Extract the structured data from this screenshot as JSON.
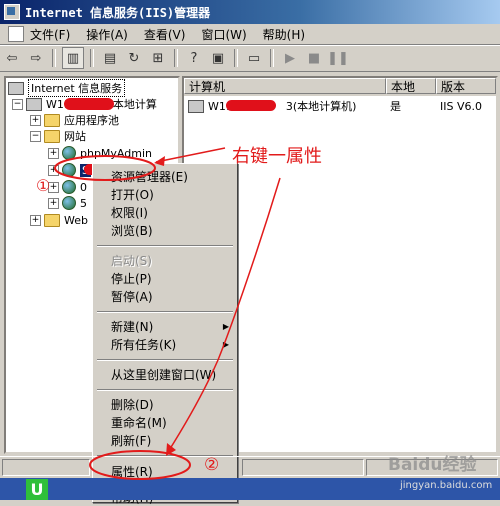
{
  "window": {
    "title": "Internet 信息服务(IIS)管理器"
  },
  "menubar": {
    "items": [
      "文件(F)",
      "操作(A)",
      "查看(V)",
      "窗口(W)",
      "帮助(H)"
    ]
  },
  "tree": {
    "root": "Internet 信息服务",
    "computer": "W11",
    "computer_suffix": "本地计算",
    "app_pools": "应用程序池",
    "sites": "网站",
    "site_phpmyadmin": "phpMyAdmin",
    "site_2": "S",
    "site_3": "0",
    "site_4": "5",
    "web_ext": "Web"
  },
  "list": {
    "headers": [
      "计算机",
      "本地",
      "版本"
    ],
    "rows": [
      {
        "computer_prefix": "W116",
        "computer_mid": "3",
        "computer_suffix": "(本地计算机)",
        "local": "是",
        "version": "IIS V6.0"
      }
    ]
  },
  "context_menu": {
    "items": [
      {
        "label": "资源管理器(E)",
        "disabled": false
      },
      {
        "label": "打开(O)",
        "disabled": false
      },
      {
        "label": "权限(I)",
        "disabled": false
      },
      {
        "label": "浏览(B)",
        "disabled": false
      },
      {
        "label": "启动(S)",
        "disabled": true
      },
      {
        "label": "停止(P)",
        "disabled": false
      },
      {
        "label": "暂停(A)",
        "disabled": false
      },
      {
        "label": "新建(N)",
        "disabled": false,
        "submenu": true
      },
      {
        "label": "所有任务(K)",
        "disabled": false,
        "submenu": true
      },
      {
        "label": "从这里创建窗口(W)",
        "disabled": false
      },
      {
        "label": "删除(D)",
        "disabled": false
      },
      {
        "label": "重命名(M)",
        "disabled": false
      },
      {
        "label": "刷新(F)",
        "disabled": false
      },
      {
        "label": "属性(R)",
        "disabled": false
      },
      {
        "label": "帮助(H)",
        "disabled": false
      }
    ]
  },
  "annotations": {
    "right_click_note": "右键一属性",
    "step1": "①",
    "step2": "②",
    "color": "#e21b1b"
  },
  "watermark": {
    "brand": "Baidu经验",
    "url": "jingyan.baidu.com"
  },
  "taskbar": {
    "icon_glyph": "U"
  }
}
